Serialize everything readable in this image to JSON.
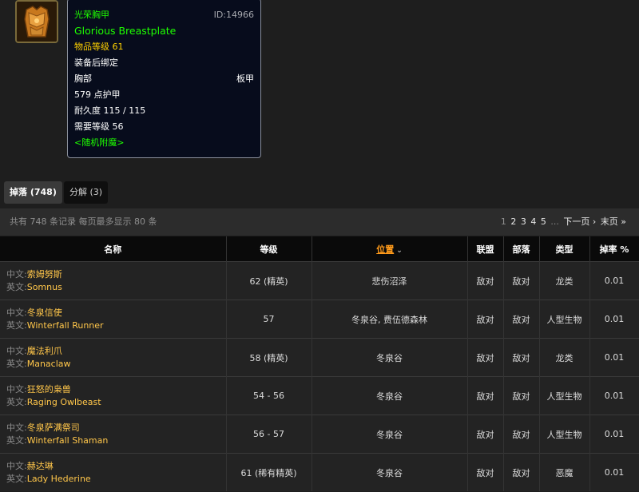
{
  "item": {
    "icon": "breastplate-icon",
    "name_cn": "光荣胸甲",
    "id_label": "ID:14966",
    "name_en": "Glorious Breastplate",
    "item_level": "物品等级 61",
    "bind": "装备后绑定",
    "slot": "胸部",
    "armor_type": "板甲",
    "armor": "579 点护甲",
    "durability": "耐久度 115 / 115",
    "required_level": "需要等级 56",
    "random_enchant": "<随机附魔>"
  },
  "tabs": [
    {
      "label": "掉落 (748)",
      "active": true
    },
    {
      "label": "分解 (3)",
      "active": false
    }
  ],
  "records": {
    "summary": "共有 748 条记录 每页最多显示 80 条",
    "pager": {
      "pages": [
        "1",
        "2",
        "3",
        "4",
        "5"
      ],
      "ellipsis": "...",
      "next": "下一页 ›",
      "last": "末页 »"
    }
  },
  "table": {
    "headers": [
      "名称",
      "等级",
      "位置",
      "联盟",
      "部落",
      "类型",
      "掉率 %"
    ],
    "cn_prefix": "中文:",
    "en_prefix": "英文:",
    "rows": [
      {
        "cn": "索姆努斯",
        "en": "Somnus",
        "level": "62 (精英)",
        "location": "悲伤沼泽",
        "alliance": "敌对",
        "horde": "敌对",
        "type": "龙类",
        "rate": "0.01"
      },
      {
        "cn": "冬泉信使",
        "en": "Winterfall Runner",
        "level": "57",
        "location": "冬泉谷, 费伍德森林",
        "alliance": "敌对",
        "horde": "敌对",
        "type": "人型生物",
        "rate": "0.01"
      },
      {
        "cn": "魔法利爪",
        "en": "Manaclaw",
        "level": "58 (精英)",
        "location": "冬泉谷",
        "alliance": "敌对",
        "horde": "敌对",
        "type": "龙类",
        "rate": "0.01"
      },
      {
        "cn": "狂怒的枭兽",
        "en": "Raging Owlbeast",
        "level": "54 - 56",
        "location": "冬泉谷",
        "alliance": "敌对",
        "horde": "敌对",
        "type": "人型生物",
        "rate": "0.01"
      },
      {
        "cn": "冬泉萨满祭司",
        "en": "Winterfall Shaman",
        "level": "56 - 57",
        "location": "冬泉谷",
        "alliance": "敌对",
        "horde": "敌对",
        "type": "人型生物",
        "rate": "0.01"
      },
      {
        "cn": "赫达琳",
        "en": "Lady Hederine",
        "level": "61 (稀有精英)",
        "location": "冬泉谷",
        "alliance": "敌对",
        "horde": "敌对",
        "type": "恶魔",
        "rate": "0.01"
      }
    ]
  },
  "colors": {
    "uncommon_green": "#1eff00",
    "item_level_yellow": "#ffd100",
    "npc_name": "#ffc64a",
    "hostile_red": "#ff2020",
    "sort_orange": "#ff9a1a"
  }
}
